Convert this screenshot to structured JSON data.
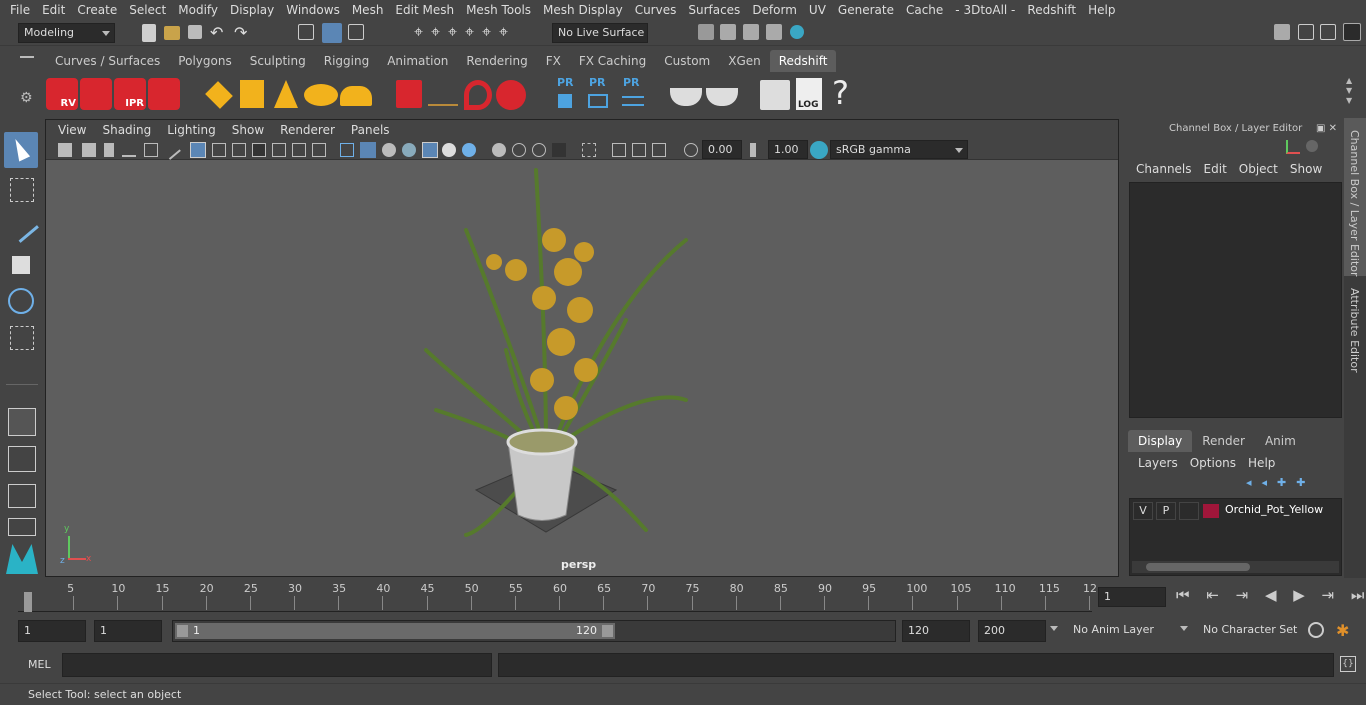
{
  "menu": [
    "File",
    "Edit",
    "Create",
    "Select",
    "Modify",
    "Display",
    "Windows",
    "Mesh",
    "Edit Mesh",
    "Mesh Tools",
    "Mesh Display",
    "Curves",
    "Surfaces",
    "Deform",
    "UV",
    "Generate",
    "Cache",
    "- 3DtoAll -",
    "Redshift",
    "Help"
  ],
  "status": {
    "workspace": "Modeling",
    "live_surface": "No Live Surface"
  },
  "shelf_tabs": [
    "Curves / Surfaces",
    "Polygons",
    "Sculpting",
    "Rigging",
    "Animation",
    "Rendering",
    "FX",
    "FX Caching",
    "Custom",
    "XGen",
    "Redshift"
  ],
  "shelf_active": "Redshift",
  "shelf_labels": {
    "rv": "RV",
    "ipr": "IPR",
    "pr1": "PR",
    "pr2": "PR",
    "pr3": "PR",
    "log": "LOG",
    "help": "?"
  },
  "viewport": {
    "menu": [
      "View",
      "Shading",
      "Lighting",
      "Show",
      "Renderer",
      "Panels"
    ],
    "exposure": "0.00",
    "gamma": "1.00",
    "colorspace": "sRGB gamma",
    "camera_label": "persp",
    "axis": {
      "x": "x",
      "y": "y",
      "z": "z"
    }
  },
  "channel_box": {
    "title": "Channel Box / Layer Editor",
    "menu": [
      "Channels",
      "Edit",
      "Object",
      "Show"
    ]
  },
  "layer_editor": {
    "tabs": [
      "Display",
      "Render",
      "Anim"
    ],
    "active_tab": "Display",
    "menu": [
      "Layers",
      "Options",
      "Help"
    ],
    "layers": [
      {
        "v": "V",
        "p": "P",
        "color": "#a0163a",
        "name": "Orchid_Pot_Yellow"
      }
    ]
  },
  "side_tabs": [
    "Channel Box / Layer Editor",
    "Attribute Editor"
  ],
  "timeline": {
    "ticks": [
      "1",
      "5",
      "10",
      "15",
      "20",
      "25",
      "30",
      "35",
      "40",
      "45",
      "50",
      "55",
      "60",
      "65",
      "70",
      "75",
      "80",
      "85",
      "90",
      "95",
      "100",
      "105",
      "110",
      "115",
      "12"
    ],
    "current_frame": "1"
  },
  "range": {
    "start": "1",
    "playback_start": "1",
    "slider_start": "1",
    "slider_end": "120",
    "playback_end": "120",
    "end": "200",
    "anim_layer": "No Anim Layer",
    "character_set": "No Character Set"
  },
  "command": {
    "lang": "MEL"
  },
  "help_line": "Select Tool: select an object",
  "colors": {
    "accent_tab": "#5d5d5d",
    "redshift_red": "#d8262e",
    "layer_color": "#a0163a",
    "viewport_bg": "#5e5e5e"
  }
}
